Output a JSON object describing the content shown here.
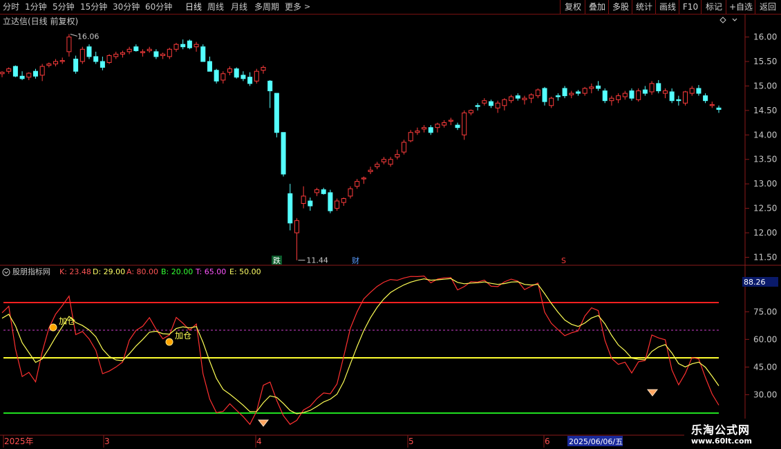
{
  "toolbar": {
    "periods": [
      "分时",
      "1分钟",
      "5分钟",
      "15分钟",
      "30分钟",
      "60分钟",
      "日线",
      "周线",
      "月线",
      "多周期",
      "更多"
    ],
    "active": "日线",
    "right_buttons": [
      "复权",
      "叠加",
      "多股",
      "统计",
      "画线",
      "F10",
      "标记",
      "+自选",
      "返回"
    ]
  },
  "stock_title": "立达信(日线 前复权)",
  "colors": {
    "up": "#ff3c3c",
    "down": "#54ffff",
    "bg": "#000000",
    "grid": "#8b1a1a"
  },
  "price_axis": {
    "labels": [
      "16.00",
      "15.50",
      "15.00",
      "14.50",
      "14.00",
      "13.50",
      "13.00",
      "12.50",
      "12.00",
      "11.50"
    ],
    "min": 11.45,
    "max": 16.22
  },
  "annotations": {
    "high": "16.06",
    "low": "11.44",
    "event_markers": [
      "跌",
      "财",
      "S"
    ]
  },
  "indicator": {
    "name": "股朋指标网",
    "params": [
      {
        "label": "K: 23.48",
        "color": "#ff5555"
      },
      {
        "label": "D: 29.00",
        "color": "#ffff66"
      },
      {
        "label": "A: 80.00",
        "color": "#ff5555"
      },
      {
        "label": "B: 20.00",
        "color": "#33ff33"
      },
      {
        "label": "T: 65.00",
        "color": "#ff55ff"
      },
      {
        "label": "E: 50.00",
        "color": "#ffff66"
      }
    ],
    "current_value": "88.26",
    "axis_labels": [
      "75.00",
      "60.00",
      "45.00",
      "30.00"
    ],
    "levels": {
      "A": 80,
      "B": 20,
      "T": 65,
      "E": 50
    },
    "signal_label": "加仓"
  },
  "date_axis": {
    "labels": [
      "2025年",
      "3",
      "4",
      "5",
      "6"
    ],
    "highlight": "2025/06/06/五"
  },
  "watermark": {
    "name": "乐淘公式网",
    "url": "www.60lt.com"
  },
  "chart_data": {
    "type": "candlestick",
    "ohlc": [
      [
        15.25,
        15.3,
        15.18,
        15.28
      ],
      [
        15.3,
        15.38,
        15.25,
        15.35
      ],
      [
        15.4,
        15.42,
        15.18,
        15.2
      ],
      [
        15.2,
        15.3,
        15.12,
        15.15
      ],
      [
        15.18,
        15.28,
        15.12,
        15.26
      ],
      [
        15.3,
        15.35,
        15.15,
        15.2
      ],
      [
        15.22,
        15.45,
        15.1,
        15.4
      ],
      [
        15.42,
        15.48,
        15.38,
        15.45
      ],
      [
        15.45,
        15.55,
        15.4,
        15.5
      ],
      [
        15.5,
        15.58,
        15.45,
        15.52
      ],
      [
        15.7,
        16.06,
        15.6,
        16.0
      ],
      [
        15.55,
        15.62,
        15.25,
        15.3
      ],
      [
        15.5,
        15.8,
        15.45,
        15.75
      ],
      [
        15.8,
        15.85,
        15.55,
        15.6
      ],
      [
        15.6,
        15.7,
        15.45,
        15.5
      ],
      [
        15.5,
        15.6,
        15.32,
        15.38
      ],
      [
        15.48,
        15.65,
        15.45,
        15.62
      ],
      [
        15.6,
        15.7,
        15.55,
        15.65
      ],
      [
        15.65,
        15.72,
        15.58,
        15.68
      ],
      [
        15.7,
        15.8,
        15.65,
        15.75
      ],
      [
        15.8,
        15.85,
        15.7,
        15.72
      ],
      [
        15.68,
        15.75,
        15.6,
        15.7
      ],
      [
        15.72,
        15.8,
        15.68,
        15.75
      ],
      [
        15.7,
        15.75,
        15.55,
        15.6
      ],
      [
        15.62,
        15.68,
        15.55,
        15.65
      ],
      [
        15.6,
        15.78,
        15.55,
        15.75
      ],
      [
        15.75,
        15.88,
        15.7,
        15.85
      ],
      [
        15.85,
        15.95,
        15.75,
        15.8
      ],
      [
        15.92,
        15.95,
        15.75,
        15.78
      ],
      [
        15.8,
        15.9,
        15.7,
        15.85
      ],
      [
        15.8,
        15.85,
        15.55,
        15.5
      ],
      [
        15.5,
        15.6,
        15.3,
        15.3
      ],
      [
        15.32,
        15.35,
        15.05,
        15.1
      ],
      [
        15.12,
        15.3,
        15.05,
        15.25
      ],
      [
        15.28,
        15.4,
        15.22,
        15.35
      ],
      [
        15.35,
        15.38,
        15.15,
        15.18
      ],
      [
        15.22,
        15.3,
        15.1,
        15.15
      ],
      [
        15.18,
        15.28,
        15.0,
        15.05
      ],
      [
        15.1,
        15.35,
        15.05,
        15.3
      ],
      [
        15.32,
        15.42,
        15.25,
        15.38
      ],
      [
        15.1,
        15.12,
        14.55,
        14.9
      ],
      [
        14.85,
        14.85,
        13.95,
        14.05
      ],
      [
        14.05,
        14.05,
        13.15,
        13.2
      ],
      [
        12.8,
        13.0,
        12.05,
        12.2
      ],
      [
        12.0,
        12.3,
        11.44,
        12.25
      ],
      [
        12.6,
        12.95,
        12.5,
        12.75
      ],
      [
        12.65,
        12.72,
        12.45,
        12.55
      ],
      [
        12.82,
        12.92,
        12.75,
        12.88
      ],
      [
        12.88,
        12.92,
        12.78,
        12.8
      ],
      [
        12.82,
        12.88,
        12.4,
        12.45
      ],
      [
        12.5,
        12.7,
        12.45,
        12.65
      ],
      [
        12.62,
        12.72,
        12.55,
        12.7
      ],
      [
        12.75,
        12.95,
        12.7,
        12.9
      ],
      [
        12.95,
        13.1,
        12.9,
        13.05
      ],
      [
        13.1,
        13.15,
        13.0,
        13.12
      ],
      [
        13.25,
        13.35,
        13.2,
        13.28
      ],
      [
        13.35,
        13.45,
        13.3,
        13.4
      ],
      [
        13.45,
        13.55,
        13.4,
        13.5
      ],
      [
        13.4,
        13.55,
        13.35,
        13.5
      ],
      [
        13.55,
        13.7,
        13.5,
        13.6
      ],
      [
        13.65,
        13.9,
        13.6,
        13.85
      ],
      [
        13.88,
        14.1,
        13.85,
        14.05
      ],
      [
        14.05,
        14.15,
        14.0,
        14.08
      ],
      [
        14.12,
        14.2,
        14.05,
        14.15
      ],
      [
        14.15,
        14.2,
        14.0,
        14.05
      ],
      [
        14.15,
        14.25,
        14.05,
        14.22
      ],
      [
        14.2,
        14.3,
        14.15,
        14.25
      ],
      [
        14.28,
        14.35,
        14.2,
        14.3
      ],
      [
        14.2,
        14.25,
        14.1,
        14.15
      ],
      [
        14.0,
        14.5,
        13.9,
        14.45
      ],
      [
        14.45,
        14.52,
        14.4,
        14.5
      ],
      [
        14.6,
        14.65,
        14.5,
        14.58
      ],
      [
        14.65,
        14.75,
        14.6,
        14.7
      ],
      [
        14.68,
        14.72,
        14.55,
        14.6
      ],
      [
        14.55,
        14.7,
        14.45,
        14.65
      ],
      [
        14.6,
        14.75,
        14.5,
        14.72
      ],
      [
        14.7,
        14.82,
        14.65,
        14.78
      ],
      [
        14.8,
        14.85,
        14.7,
        14.75
      ],
      [
        14.72,
        14.8,
        14.62,
        14.75
      ],
      [
        14.75,
        14.85,
        14.65,
        14.82
      ],
      [
        14.8,
        14.95,
        14.75,
        14.92
      ],
      [
        14.95,
        14.98,
        14.6,
        14.68
      ],
      [
        14.6,
        14.78,
        14.55,
        14.75
      ],
      [
        14.8,
        14.85,
        14.7,
        14.78
      ],
      [
        14.95,
        15.0,
        14.75,
        14.8
      ],
      [
        14.82,
        14.9,
        14.75,
        14.85
      ],
      [
        14.88,
        14.92,
        14.8,
        14.85
      ],
      [
        14.85,
        14.98,
        14.8,
        14.95
      ],
      [
        14.95,
        15.05,
        14.85,
        14.98
      ],
      [
        15.0,
        15.1,
        14.9,
        14.95
      ],
      [
        14.9,
        14.95,
        14.65,
        14.7
      ],
      [
        14.7,
        14.8,
        14.6,
        14.75
      ],
      [
        14.72,
        14.85,
        14.65,
        14.8
      ],
      [
        14.78,
        14.9,
        14.72,
        14.85
      ],
      [
        14.9,
        14.95,
        14.7,
        14.75
      ],
      [
        14.72,
        14.95,
        14.68,
        14.9
      ],
      [
        14.92,
        15.0,
        14.8,
        14.85
      ],
      [
        14.88,
        15.1,
        14.82,
        15.05
      ],
      [
        15.05,
        15.12,
        14.85,
        14.9
      ],
      [
        14.85,
        14.95,
        14.75,
        14.9
      ],
      [
        14.88,
        14.95,
        14.65,
        14.7
      ],
      [
        14.72,
        14.8,
        14.6,
        14.7
      ],
      [
        14.65,
        14.9,
        14.6,
        14.88
      ],
      [
        14.85,
        15.0,
        14.8,
        14.95
      ],
      [
        14.95,
        15.02,
        14.8,
        14.85
      ],
      [
        14.8,
        14.85,
        14.65,
        14.7
      ],
      [
        14.6,
        14.68,
        14.55,
        14.62
      ],
      [
        14.55,
        14.6,
        14.45,
        14.52
      ]
    ]
  }
}
